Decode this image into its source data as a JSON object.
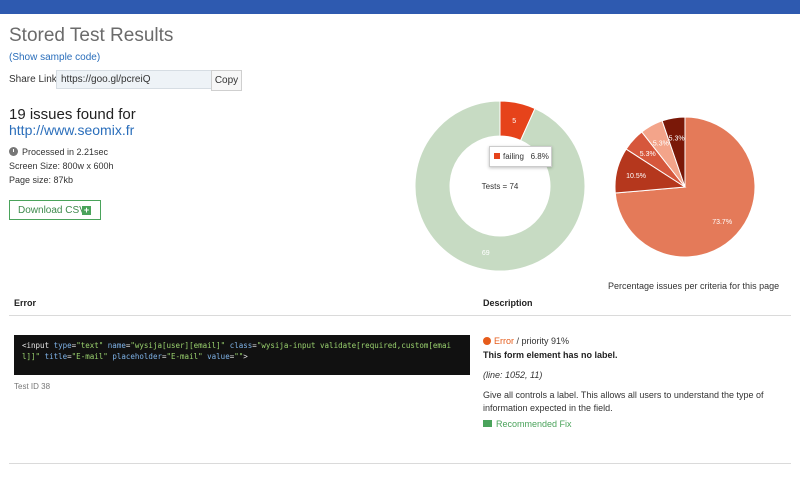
{
  "header": {
    "title": "Stored Test Results",
    "sample_link": "(Show sample code)"
  },
  "share": {
    "label": "Share Link:",
    "value": "https://goo.gl/pcreiQ",
    "copy_label": "Copy"
  },
  "summary": {
    "issues_text": "19 issues found for",
    "url": "http://www.seomix.fr",
    "processed": "Processed in 2.21sec",
    "screen_size": "Screen Size: 800w x 600h",
    "page_size": "Page size: 87kb",
    "csv_label": "Download CSV"
  },
  "colors": {
    "topbar": "#2e5ab0",
    "link": "#2a6ebb",
    "accent_green": "#4aa35b",
    "error": "#e65c1b"
  },
  "chart_data": [
    {
      "type": "pie",
      "variant": "donut",
      "center_label": "Tests = 74",
      "slices": [
        {
          "label": "failing",
          "value": 5,
          "percent": 6.8,
          "color": "#e6431b"
        },
        {
          "label": "",
          "value": 69,
          "color": "#c7dbc3"
        }
      ],
      "tooltip": {
        "label": "failing",
        "value": "6.8%"
      }
    },
    {
      "type": "pie",
      "caption": "Percentage issues per criteria for this page",
      "slices": [
        {
          "value": 73.7,
          "label": "73.7%",
          "color": "#e47a59"
        },
        {
          "value": 10.5,
          "label": "10.5%",
          "color": "#b5371d"
        },
        {
          "value": 5.3,
          "label": "5.3%",
          "color": "#d6573c"
        },
        {
          "value": 5.3,
          "label": "5.3%",
          "color": "#f3a48a"
        },
        {
          "value": 5.3,
          "label": "5.3%",
          "color": "#7a1808"
        }
      ]
    }
  ],
  "table": {
    "headers": {
      "error": "Error",
      "description": "Description"
    },
    "row": {
      "code_tag": "<input",
      "code_attrs": [
        {
          "name": "type",
          "value": "\"text\""
        },
        {
          "name": "name",
          "value": "\"wysija[user][email]\""
        },
        {
          "name": "class",
          "value": "\"wysija-input validate[required,custom[email]]\""
        },
        {
          "name": "title",
          "value": "\"E-mail\""
        },
        {
          "name": "placeholder",
          "value": "\"E-mail\""
        },
        {
          "name": "value",
          "value": "\"\""
        }
      ],
      "code_end": ">",
      "test_id": "Test ID 38",
      "error_word": "Error",
      "priority": "/  priority 91%",
      "title": "This form element has no label.",
      "line_ref": "(line: 1052, 11)",
      "description": "Give all controls a label. This allows all users to understand the type of information expected in the field.",
      "fix_label": "Recommended Fix"
    }
  }
}
